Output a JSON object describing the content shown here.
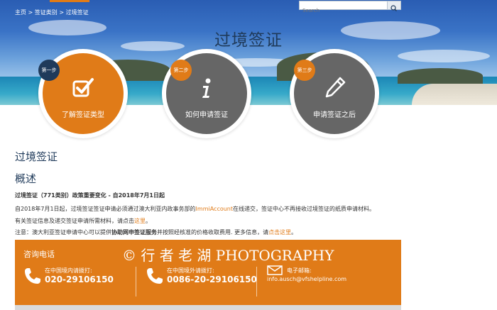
{
  "search": {
    "placeholder": "Search"
  },
  "breadcrumb": {
    "home": "主页",
    "sep1": " > ",
    "cat": "签证类别",
    "sep2": " > ",
    "current": "过境签证"
  },
  "hero": {
    "title": "过境签证"
  },
  "steps": [
    {
      "badge": "第一步",
      "label": "了解签证类型",
      "icon": "checkbox-icon",
      "color": "#e07b18"
    },
    {
      "badge": "第二步",
      "label": "如何申请签证",
      "icon": "info-icon",
      "color": "#666666"
    },
    {
      "badge": "第三步",
      "label": "申请签证之后",
      "icon": "pencil-icon",
      "color": "#666666"
    }
  ],
  "content": {
    "heading": "过境签证",
    "subheading": "概述",
    "important": "过境签证（771类别）政策重要变化 - 自2018年7月1日起",
    "p1_before": "自2018年7月1日起，过境签证签证申请必须通过澳大利亚内政事务部的",
    "p1_link": "ImmiAccount",
    "p1_after": "在线递交，签证中心不再接收过境签证的纸质申请材料。",
    "p2_before": "有关签证信息及递交签证申请所需材料，请点击",
    "p2_link": "这里",
    "p2_after": "。",
    "p3_before": "注意：澳大利亚签证申请中心可以提供",
    "p3_bold": "协助网申签证服务",
    "p3_middle": "并按照经核准的价格收取费用. 更多信息，请",
    "p3_link": "点击这里",
    "p3_after": "。"
  },
  "contact": {
    "title": "咨询电话",
    "domestic_label": "在中国境内请拨打:",
    "domestic_number": "020-29106150",
    "overseas_label": "在中国境外请拨打:",
    "overseas_number": "0086-20-29106150",
    "email_label": "电子邮箱:",
    "email": "info.ausch@vfshelpline.com"
  },
  "watermark": "© 行 者 老 湖 PHOTOGRAPHY",
  "colors": {
    "accent": "#e07b18",
    "navy": "#1f3a5a",
    "gray": "#666666"
  }
}
